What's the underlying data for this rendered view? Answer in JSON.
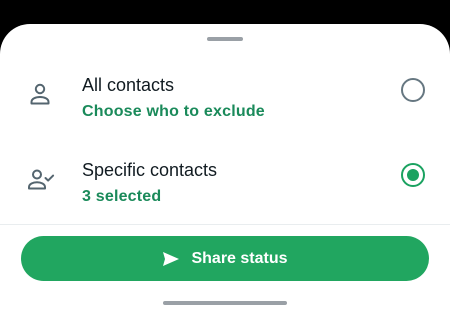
{
  "sheet": {
    "options": [
      {
        "title": "All contacts",
        "subtitle": "Choose who to exclude",
        "icon": "person-icon",
        "selected": false
      },
      {
        "title": "Specific contacts",
        "subtitle": "3 selected",
        "icon": "person-check-icon",
        "selected": true
      }
    ],
    "share_button": {
      "label": "Share status",
      "icon": "send-icon"
    }
  },
  "colors": {
    "accent": "#1aa260",
    "button": "#21a660",
    "subtitle": "#1a8a5a",
    "text": "#111b21"
  }
}
